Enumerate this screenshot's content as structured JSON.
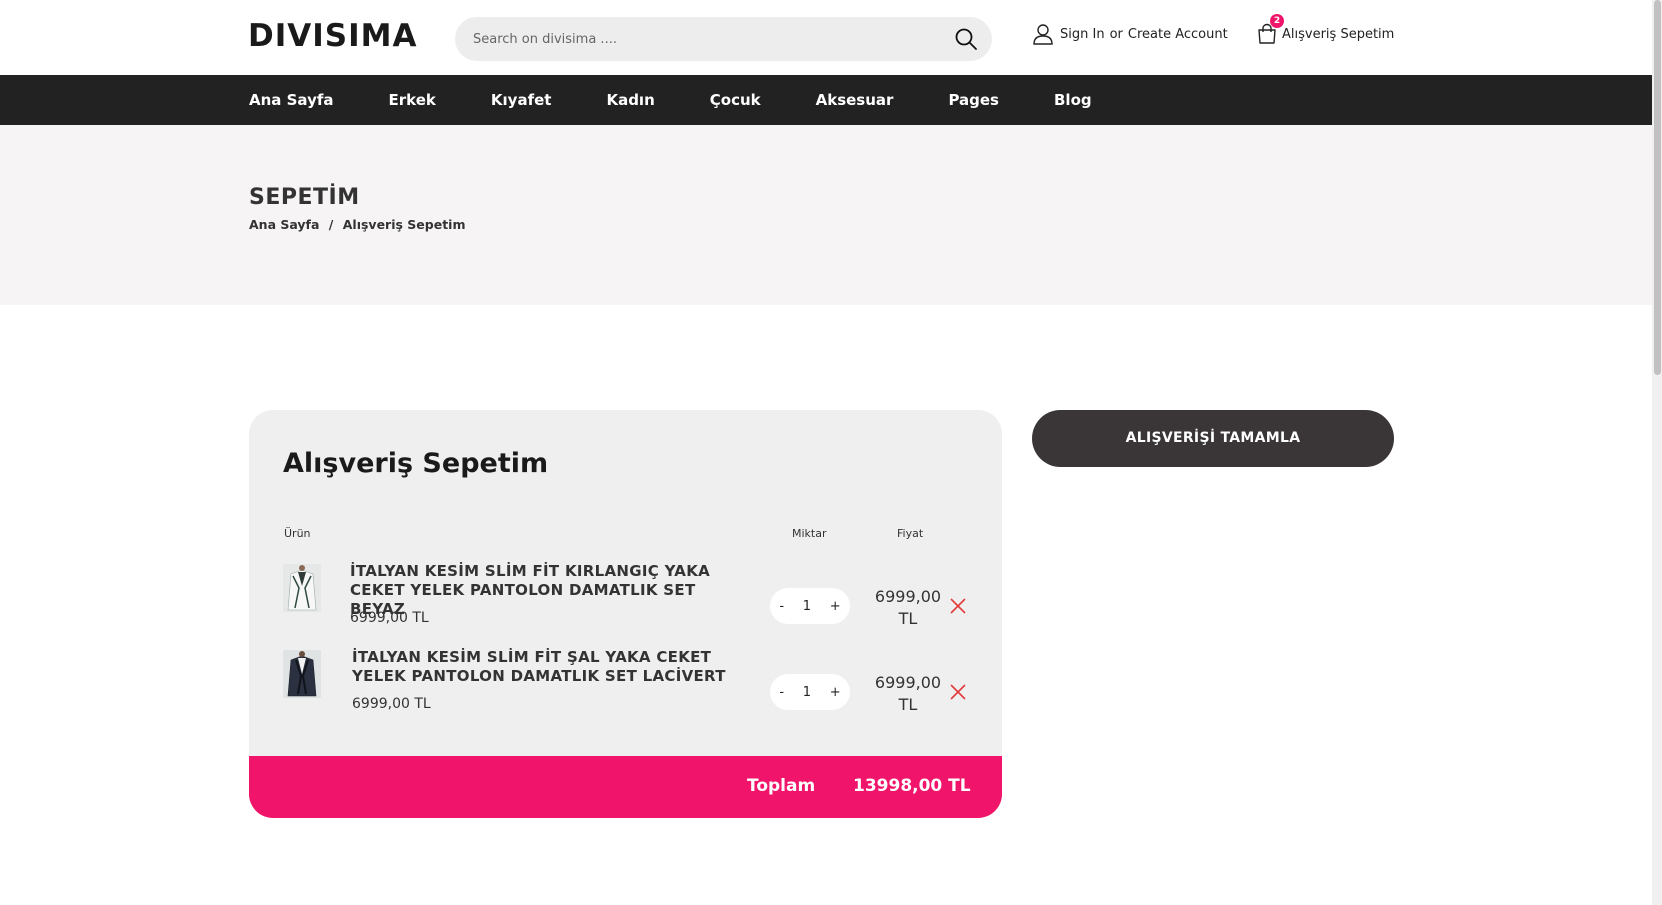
{
  "header": {
    "logo": "DIVISIMA",
    "search_placeholder": "Search on divisima ....",
    "sign_in": "Sign In",
    "or": "or",
    "create_account": "Create Account",
    "cart_count": "2",
    "cart_label": "Alışveriş Sepetim"
  },
  "nav": {
    "items": [
      "Ana Sayfa",
      "Erkek",
      "Kıyafet",
      "Kadın",
      "Çocuk",
      "Aksesuar",
      "Pages",
      "Blog"
    ]
  },
  "page": {
    "title": "SEPETİM",
    "breadcrumb_home": "Ana Sayfa",
    "breadcrumb_sep": "/",
    "breadcrumb_current": "Alışveriş Sepetim"
  },
  "cart": {
    "heading": "Alışveriş Sepetim",
    "col_product": "Ürün",
    "col_qty": "Miktar",
    "col_price": "Fiyat",
    "items": [
      {
        "name": "İTALYAN KESİM SLİM FİT KIRLANGIÇ YAKA CEKET YELEK PANTOLON DAMATLIK SET BEYAZ",
        "unit_price": "6999,00 TL",
        "qty_minus": "-",
        "qty": "1",
        "qty_plus": "+",
        "price_line1": "6999,00",
        "price_line2": "TL"
      },
      {
        "name": "İTALYAN KESİM SLİM FİT ŞAL YAKA CEKET YELEK PANTOLON DAMATLIK SET LACİVERT",
        "unit_price": "6999,00 TL",
        "qty_minus": "-",
        "qty": "1",
        "qty_plus": "+",
        "price_line1": "6999,00",
        "price_line2": "TL"
      }
    ],
    "total_label": "Toplam",
    "total_value": "13998,00 TL"
  },
  "checkout_label": "ALIŞVERİŞİ TAMAMLA",
  "colors": {
    "accent": "#f0156a",
    "nav_bg": "#222222",
    "checkout_bg": "#3a3536",
    "title_band_bg": "#f6f4f4",
    "card_bg": "#efefef"
  }
}
